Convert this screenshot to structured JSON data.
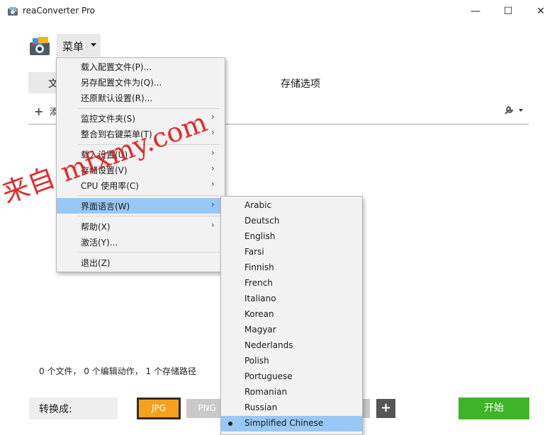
{
  "window": {
    "title": "reaConverter Pro",
    "minimize_glyph": "—",
    "maximize_glyph": "☐",
    "close_glyph": "✕"
  },
  "menu_button": {
    "label": "菜单"
  },
  "tabs": {
    "left_partial": "文",
    "storage": "存储选项"
  },
  "toolbar": {
    "add_partial": "添"
  },
  "status": {
    "text": "0 个文件， 0 个编辑动作， 1 个存储路径"
  },
  "bottom": {
    "convert_label": "转换成:",
    "formats": [
      "JPG",
      "PNG"
    ],
    "add_format_glyph": "+",
    "start_label": "开始"
  },
  "dropdown_menu": {
    "items": [
      {
        "label": "载入配置文件(P)...",
        "submenu": false
      },
      {
        "label": "另存配置文件为(Q)...",
        "submenu": false
      },
      {
        "label": "还原默认设置(R)...",
        "submenu": false
      },
      {
        "label": "监控文件夹(S)",
        "submenu": true
      },
      {
        "label": "整合到右键菜单(T)",
        "submenu": true
      },
      {
        "label": "载入设置(U)",
        "submenu": true
      },
      {
        "label": "存储设置(V)",
        "submenu": true
      },
      {
        "label": "CPU 使用率(C)",
        "submenu": true
      },
      {
        "label": "界面语言(W)",
        "submenu": true,
        "highlighted": true
      },
      {
        "label": "帮助(X)",
        "submenu": true
      },
      {
        "label": "激活(Y)...",
        "submenu": false
      },
      {
        "label": "退出(Z)",
        "submenu": false
      }
    ],
    "arrow_glyph": "›"
  },
  "language_submenu": {
    "items": [
      "Arabic",
      "Deutsch",
      "English",
      "Farsi",
      "Finnish",
      "French",
      "Italiano",
      "Korean",
      "Magyar",
      "Nederlands",
      "Polish",
      "Portuguese",
      "Romanian",
      "Russian",
      "Simplified Chinese"
    ],
    "selected": "Simplified Chinese"
  },
  "watermark": {
    "text": "来自 mfxmy.com"
  },
  "colors": {
    "highlight": "#98c8f5",
    "jpg_active": "#f5a11e",
    "start_button": "#3fb42b",
    "watermark": "#e02020"
  }
}
